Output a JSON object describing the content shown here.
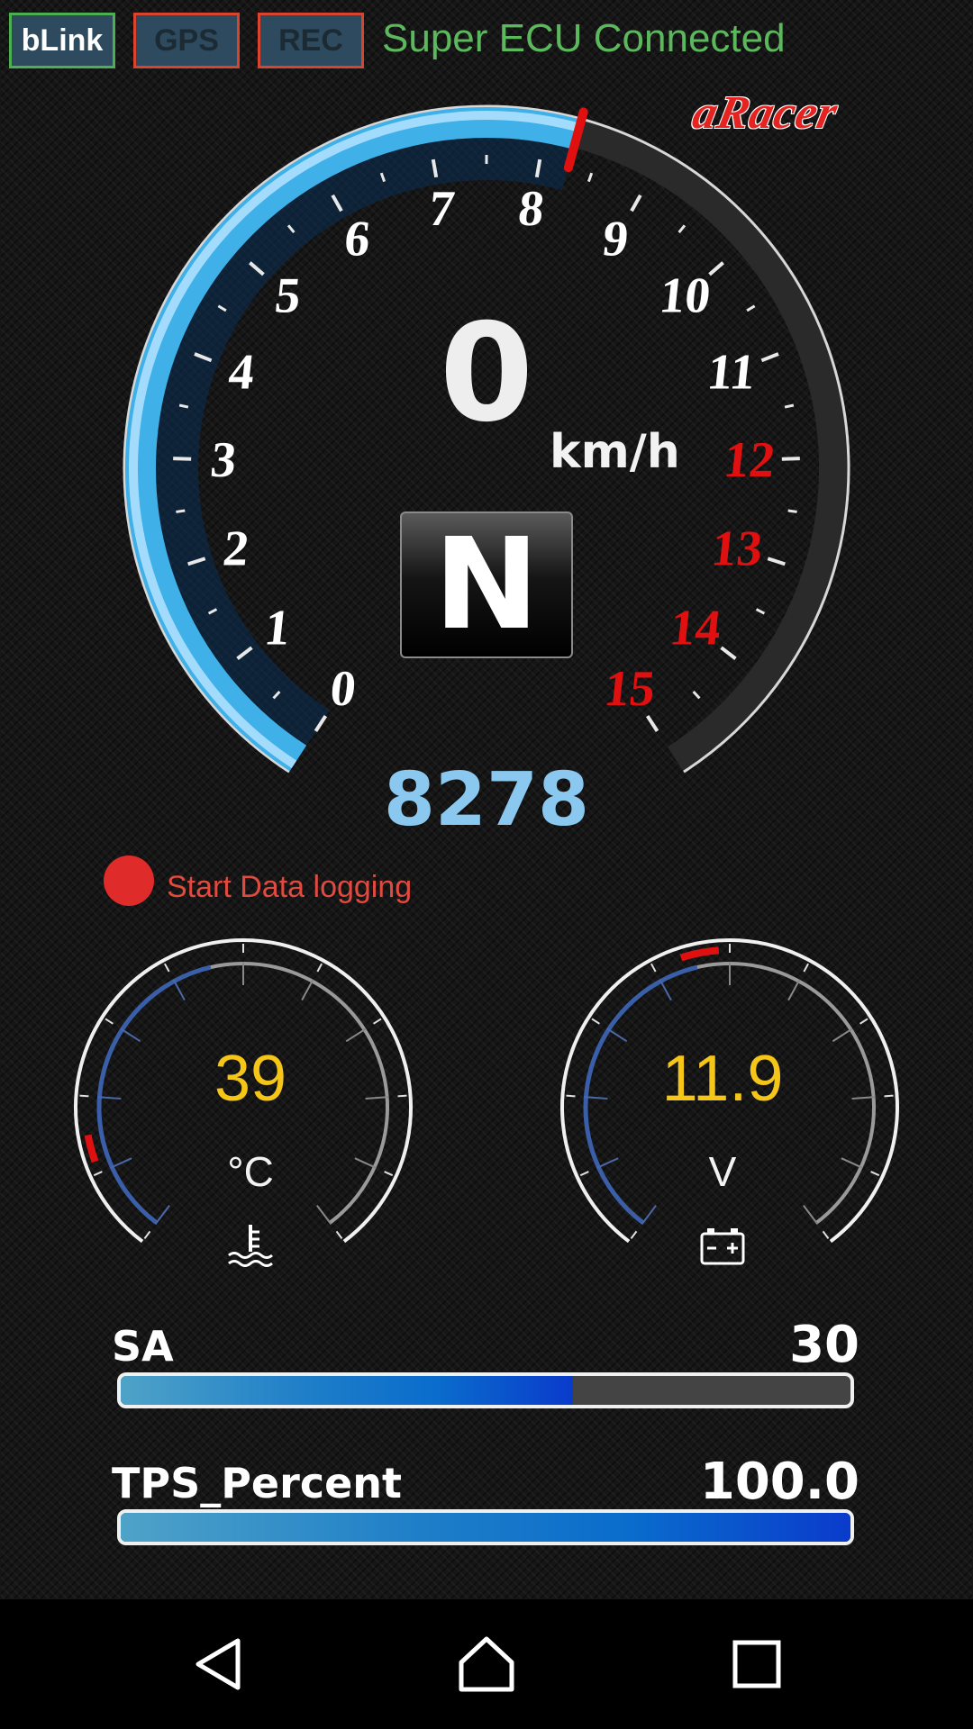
{
  "topbar": {
    "blink_label": "bLink",
    "gps_label": "GPS",
    "rec_label": "REC",
    "connection_status": "Super ECU Connected",
    "brand": "aRacer"
  },
  "tachometer": {
    "rpm_x1000_labels": [
      "0",
      "1",
      "2",
      "3",
      "4",
      "5",
      "6",
      "7",
      "8",
      "9",
      "10",
      "11",
      "12",
      "13",
      "14",
      "15"
    ],
    "redline_from": 12,
    "rpm_value": "8278",
    "rpm_needle_fraction": 0.5518,
    "speed_value": "0",
    "speed_unit": "km/h",
    "gear": "N"
  },
  "logging": {
    "label": "Start Data logging"
  },
  "coolant_gauge": {
    "value": "39",
    "unit": "°C",
    "icon": "coolant-temperature-icon"
  },
  "voltage_gauge": {
    "value": "11.9",
    "unit": "V",
    "icon": "battery-icon"
  },
  "bars": {
    "sa": {
      "label": "SA",
      "value": "30",
      "fill_fraction": 0.62
    },
    "tps": {
      "label": "TPS_Percent",
      "value": "100.0",
      "fill_fraction": 1.0
    }
  },
  "colors": {
    "accent_blue": "#3fb0e8",
    "rpm_text": "#8ac8ef",
    "redline": "#e01010",
    "status_green": "#5cb85c",
    "gauge_value": "#f5c518"
  },
  "navbar": {
    "back_icon": "back-triangle-icon",
    "home_icon": "home-icon",
    "recents_icon": "recents-square-icon"
  }
}
